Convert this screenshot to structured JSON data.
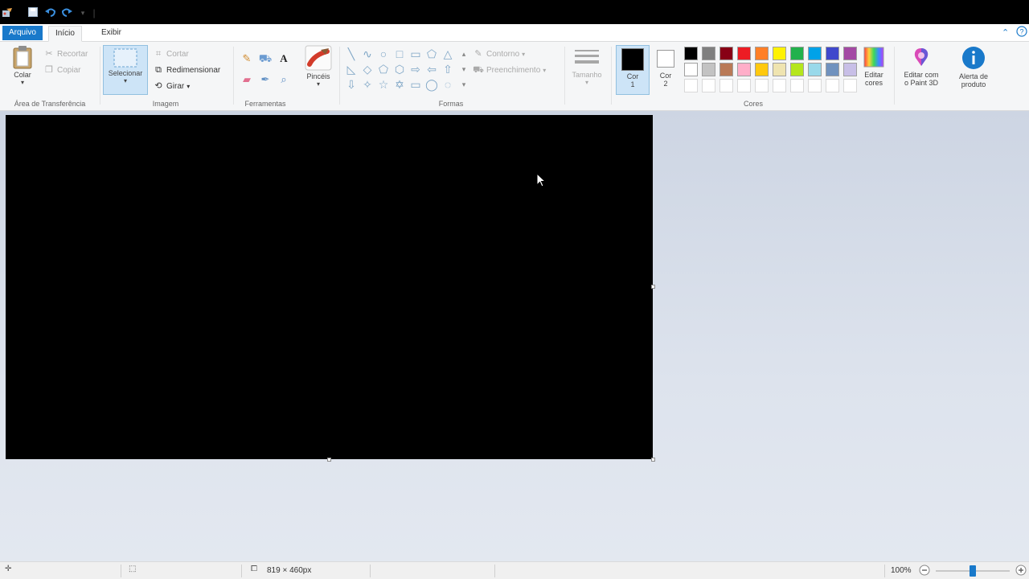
{
  "titlebar": {
    "icons": [
      "paint-app-icon",
      "save-icon",
      "undo-icon",
      "redo-icon",
      "customize-quick-access-icon"
    ]
  },
  "tabs": {
    "file": "Arquivo",
    "home": "Início",
    "view": "Exibir"
  },
  "clipboard": {
    "paste": "Colar",
    "cut": "Recortar",
    "copy": "Copiar",
    "label": "Área de Transferência"
  },
  "image": {
    "select": "Selecionar",
    "crop": "Cortar",
    "resize": "Redimensionar",
    "rotate": "Girar",
    "label": "Imagem"
  },
  "tools": {
    "label": "Ferramentas",
    "brushes": "Pincéis"
  },
  "shapes": {
    "outline": "Contorno",
    "fill": "Preenchimento",
    "label": "Formas"
  },
  "size": {
    "label": "Tamanho"
  },
  "colors": {
    "color1_a": "Cor",
    "color1_b": "1",
    "color2_a": "Cor",
    "color2_b": "2",
    "color1_value": "#000000",
    "color2_value": "#ffffff",
    "palette": [
      "#000000",
      "#7f7f7f",
      "#880015",
      "#ed1c24",
      "#ff7f27",
      "#fff200",
      "#22b14c",
      "#00a2e8",
      "#3f48cc",
      "#a349a4",
      "#ffffff",
      "#c3c3c3",
      "#b97a57",
      "#ffaec9",
      "#ffc90e",
      "#efe4b0",
      "#b5e61d",
      "#99d9ea",
      "#7092be",
      "#c8bfe7"
    ],
    "edit_a": "Editar",
    "edit_b": "cores",
    "label": "Cores"
  },
  "paint3d": {
    "line1": "Editar com",
    "line2": "o Paint 3D"
  },
  "product_alert": {
    "line1": "Alerta de",
    "line2": "produto"
  },
  "canvas": {
    "background": "#000000"
  },
  "statusbar": {
    "dimensions": "819 × 460px",
    "zoom": "100%"
  }
}
